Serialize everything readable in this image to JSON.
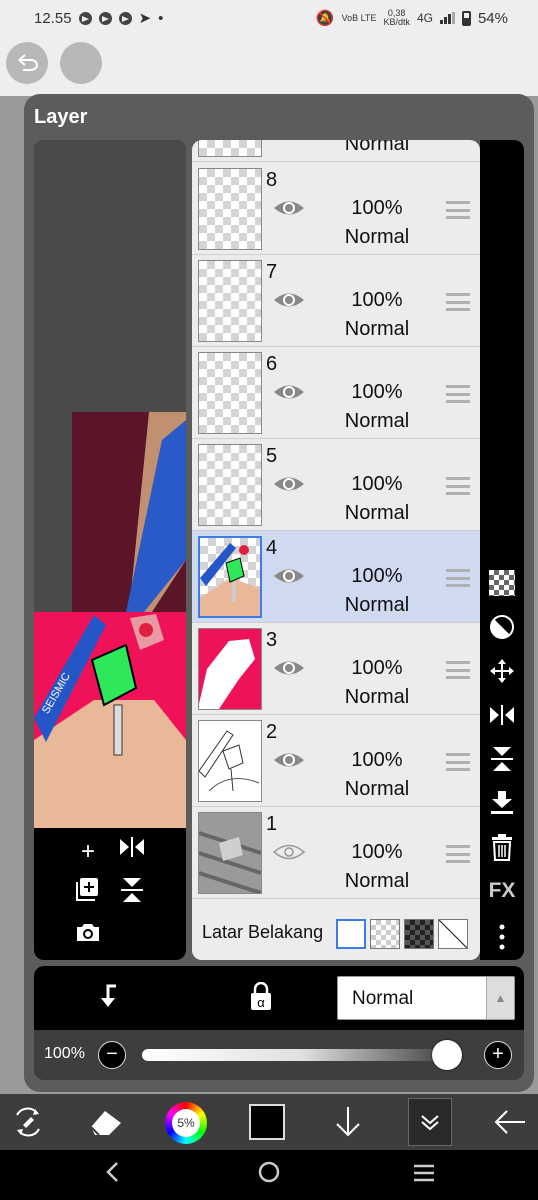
{
  "status": {
    "time": "12.55",
    "volte": "VoB LTE",
    "speed_value": "0,38",
    "speed_unit": "KB/dtk",
    "network": "4G",
    "battery": "54%"
  },
  "dialog": {
    "title": "Layer"
  },
  "layers": [
    {
      "number": "8",
      "opacity": "100%",
      "blend": "Normal"
    },
    {
      "number": "7",
      "opacity": "100%",
      "blend": "Normal"
    },
    {
      "number": "6",
      "opacity": "100%",
      "blend": "Normal"
    },
    {
      "number": "5",
      "opacity": "100%",
      "blend": "Normal"
    },
    {
      "number": "4",
      "opacity": "100%",
      "blend": "Normal"
    },
    {
      "number": "3",
      "opacity": "100%",
      "blend": "Normal"
    },
    {
      "number": "2",
      "opacity": "100%",
      "blend": "Normal"
    },
    {
      "number": "1",
      "opacity": "100%",
      "blend": "Normal"
    }
  ],
  "partial_layer_blend": "Normal",
  "background": {
    "label": "Latar Belakang"
  },
  "blend_select": {
    "value": "Normal"
  },
  "opacity": {
    "label": "100%",
    "value": 1.0
  },
  "brush_size_label": "5%",
  "preview_text": "SEISMIC",
  "colors": {
    "accent": "#3d7ce6",
    "selected_row": "#cfdaf0",
    "dialog_bg": "#5c5c5c"
  }
}
